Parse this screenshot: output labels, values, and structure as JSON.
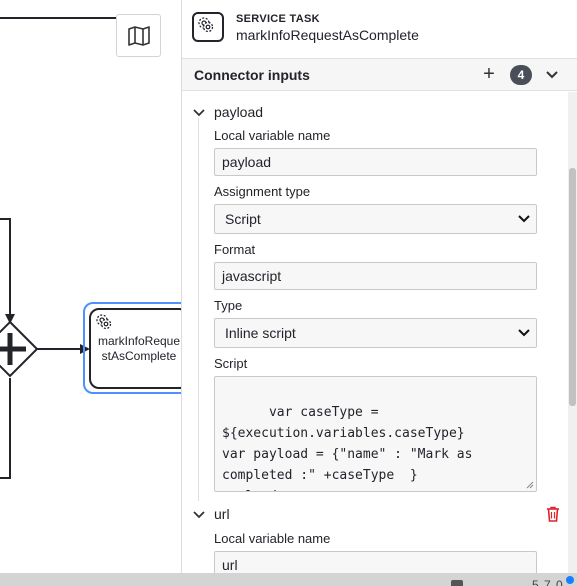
{
  "canvas": {
    "task_label": "markInfoRequestAsComplete",
    "task_label_lines": [
      "markInfoReque",
      "stAsComplete"
    ]
  },
  "header": {
    "type_label": "SERVICE TASK",
    "element_name": "markInfoRequestAsComplete"
  },
  "group": {
    "title": "Connector inputs",
    "count": "4"
  },
  "items": [
    {
      "name": "payload",
      "fields": {
        "local_variable_label": "Local variable name",
        "local_variable_value": "payload",
        "assignment_type_label": "Assignment type",
        "assignment_type_value": "Script",
        "format_label": "Format",
        "format_value": "javascript",
        "type_label": "Type",
        "type_value": "Inline script",
        "script_label": "Script",
        "script_value": "var caseType = \n${execution.variables.caseType}\nvar payload = {\"name\" : \"Mark as \ncompleted :\" +caseType  }\npayload"
      }
    },
    {
      "name": "url",
      "fields": {
        "local_variable_label": "Local variable name",
        "local_variable_value": "url"
      }
    }
  ],
  "colors": {
    "selection": "#4d90fe",
    "badge": "#4a4e58",
    "delete": "#e0232b",
    "status_dot": "#1a7cff"
  },
  "bottom_bar": {
    "version": "5.7.0"
  }
}
